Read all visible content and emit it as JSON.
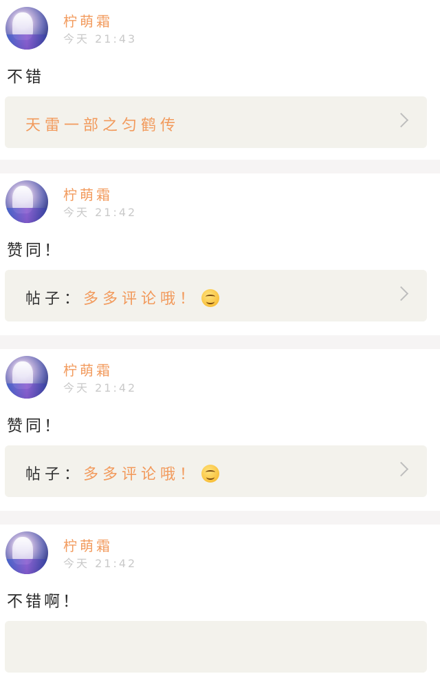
{
  "comments": [
    {
      "username": "柠萌霜",
      "time": "今天 21:43",
      "text": "不错",
      "card_prefix": "",
      "card_link": "天雷一部之匀鹤传",
      "card_emoji": false
    },
    {
      "username": "柠萌霜",
      "time": "今天 21:42",
      "text": "赞同！",
      "card_prefix": "帖子：",
      "card_link": "多多评论哦！",
      "card_emoji": true
    },
    {
      "username": "柠萌霜",
      "time": "今天 21:42",
      "text": "赞同！",
      "card_prefix": "帖子：",
      "card_link": "多多评论哦！",
      "card_emoji": true
    },
    {
      "username": "柠萌霜",
      "time": "今天 21:42",
      "text": "不错啊！",
      "card_prefix": "",
      "card_link": "",
      "card_emoji": false
    }
  ],
  "icons": {
    "avatar": "avatar-anime-girl",
    "chevron": "chevron-right-icon",
    "emoji": "smiling-face-emoji"
  },
  "colors": {
    "accent": "#f29a5c",
    "card_bg": "#f3f2ec",
    "separator": "#f6f4f4"
  }
}
